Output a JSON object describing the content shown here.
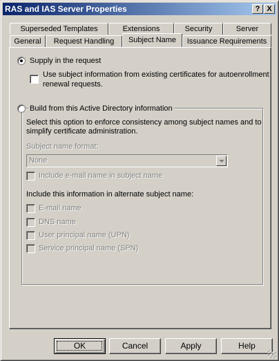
{
  "window": {
    "title": "RAS and IAS Server Properties",
    "help_btn": "?",
    "close_btn": "X"
  },
  "tabs": {
    "row_back": [
      "Superseded Templates",
      "Extensions",
      "Security",
      "Server"
    ],
    "row_front": [
      "General",
      "Request Handling",
      "Subject Name",
      "Issuance Requirements"
    ],
    "active": "Subject Name"
  },
  "subject": {
    "supply_label": "Supply in the request",
    "supply_selected": true,
    "use_existing_line1": "Use subject information from existing certificates for autoenrollment",
    "use_existing_line2": "renewal requests.",
    "use_existing_checked": false,
    "build_label": "Build from this Active Directory information",
    "build_selected": false,
    "build_desc_line1": "Select this option to enforce consistency among subject names and to",
    "build_desc_line2": "simplify certificate administration.",
    "format_label": "Subject name format:",
    "format_value": "None",
    "include_email_subject": "Include e-mail name in subject name",
    "alt_header": "Include this information in alternate subject name:",
    "alt_items": [
      "E-mail name",
      "DNS name",
      "User principal name (UPN)",
      "Service principal name (SPN)"
    ]
  },
  "buttons": {
    "ok": "OK",
    "cancel": "Cancel",
    "apply": "Apply",
    "help": "Help"
  },
  "colors": {
    "title_start": "#0a246a",
    "title_end": "#a6caf0",
    "face": "#d4d0c8",
    "disabled_text": "#808080"
  }
}
